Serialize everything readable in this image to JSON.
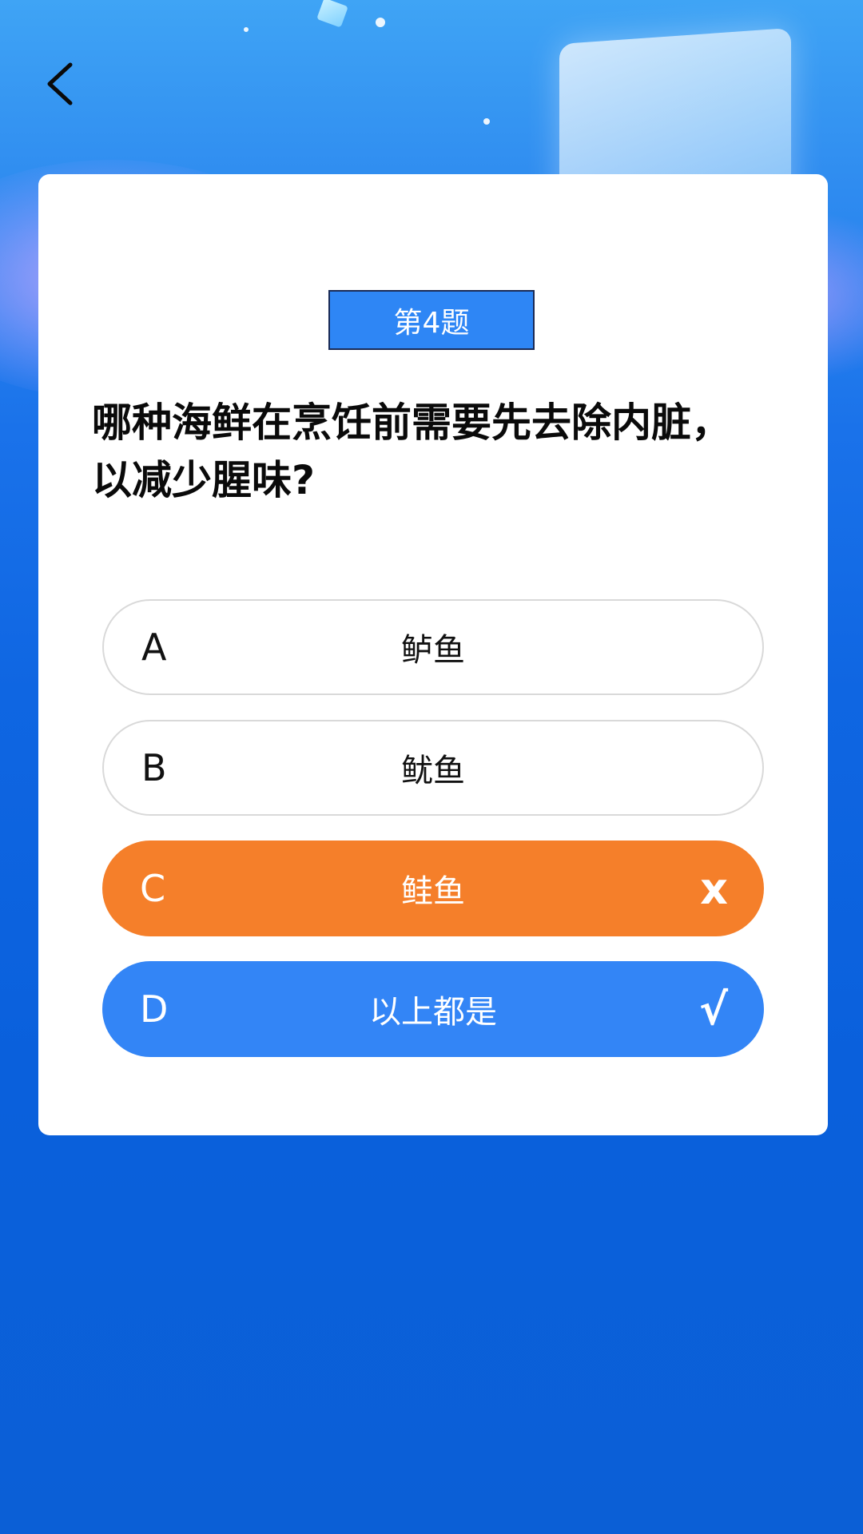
{
  "header": {
    "back_icon": "chevron-left-icon"
  },
  "quiz": {
    "number_label": "第4题",
    "question": "哪种海鲜在烹饪前需要先去除内脏，以减少腥味?",
    "options": [
      {
        "letter": "A",
        "text": "鲈鱼",
        "state": "normal",
        "mark": ""
      },
      {
        "letter": "B",
        "text": "鱿鱼",
        "state": "normal",
        "mark": ""
      },
      {
        "letter": "C",
        "text": "鲑鱼",
        "state": "wrong",
        "mark": "x"
      },
      {
        "letter": "D",
        "text": "以上都是",
        "state": "correct",
        "mark": "√"
      }
    ]
  },
  "colors": {
    "accent_blue": "#3385f6",
    "wrong_orange": "#f57f2a",
    "label_blue": "#2e86f5"
  }
}
